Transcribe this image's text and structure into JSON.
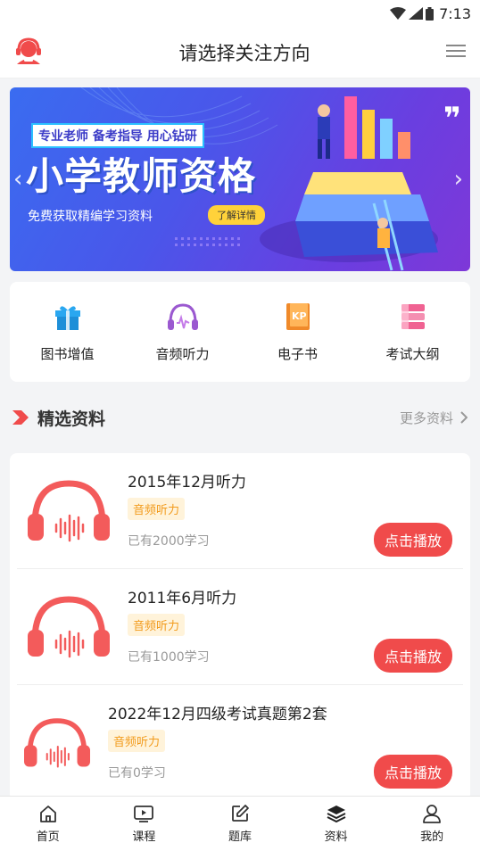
{
  "status_bar": {
    "time": "7:13"
  },
  "header": {
    "title": "请选择关注方向",
    "left_icon": "headset-logo-icon",
    "right_icon": "menu-icon"
  },
  "banner": {
    "tagline": "专业老师 备考指导 用心钻研",
    "headline": "小学教师资格",
    "subtitle": "免费获取精编学习资料",
    "button": "了解详情"
  },
  "quick_links": [
    {
      "label": "图书增值",
      "icon": "gift-icon",
      "color": "#1e9be6"
    },
    {
      "label": "音频听力",
      "icon": "headphones-icon",
      "color": "#9b59d0"
    },
    {
      "label": "电子书",
      "icon": "ebook-icon",
      "color": "#f08a2a"
    },
    {
      "label": "考试大纲",
      "icon": "outline-icon",
      "color": "#f06292"
    }
  ],
  "section": {
    "title": "精选资料",
    "more": "更多资料"
  },
  "items": [
    {
      "title": "2015年12月听力",
      "badge": "音频听力",
      "learners": "已有2000学习",
      "action": "点击播放"
    },
    {
      "title": "2011年6月听力",
      "badge": "音频听力",
      "learners": "已有1000学习",
      "action": "点击播放"
    },
    {
      "title": "2022年12月四级考试真题第2套",
      "badge": "音频听力",
      "learners": "已有0学习",
      "action": "点击播放"
    }
  ],
  "tabs": [
    {
      "label": "首页",
      "icon": "home-icon"
    },
    {
      "label": "课程",
      "icon": "video-icon"
    },
    {
      "label": "题库",
      "icon": "edit-icon"
    },
    {
      "label": "资料",
      "icon": "layers-icon",
      "active": true
    },
    {
      "label": "我的",
      "icon": "user-icon"
    }
  ],
  "colors": {
    "accent": "#f04b4b",
    "badge_text": "#f29b1c",
    "badge_bg": "#fff3da"
  }
}
